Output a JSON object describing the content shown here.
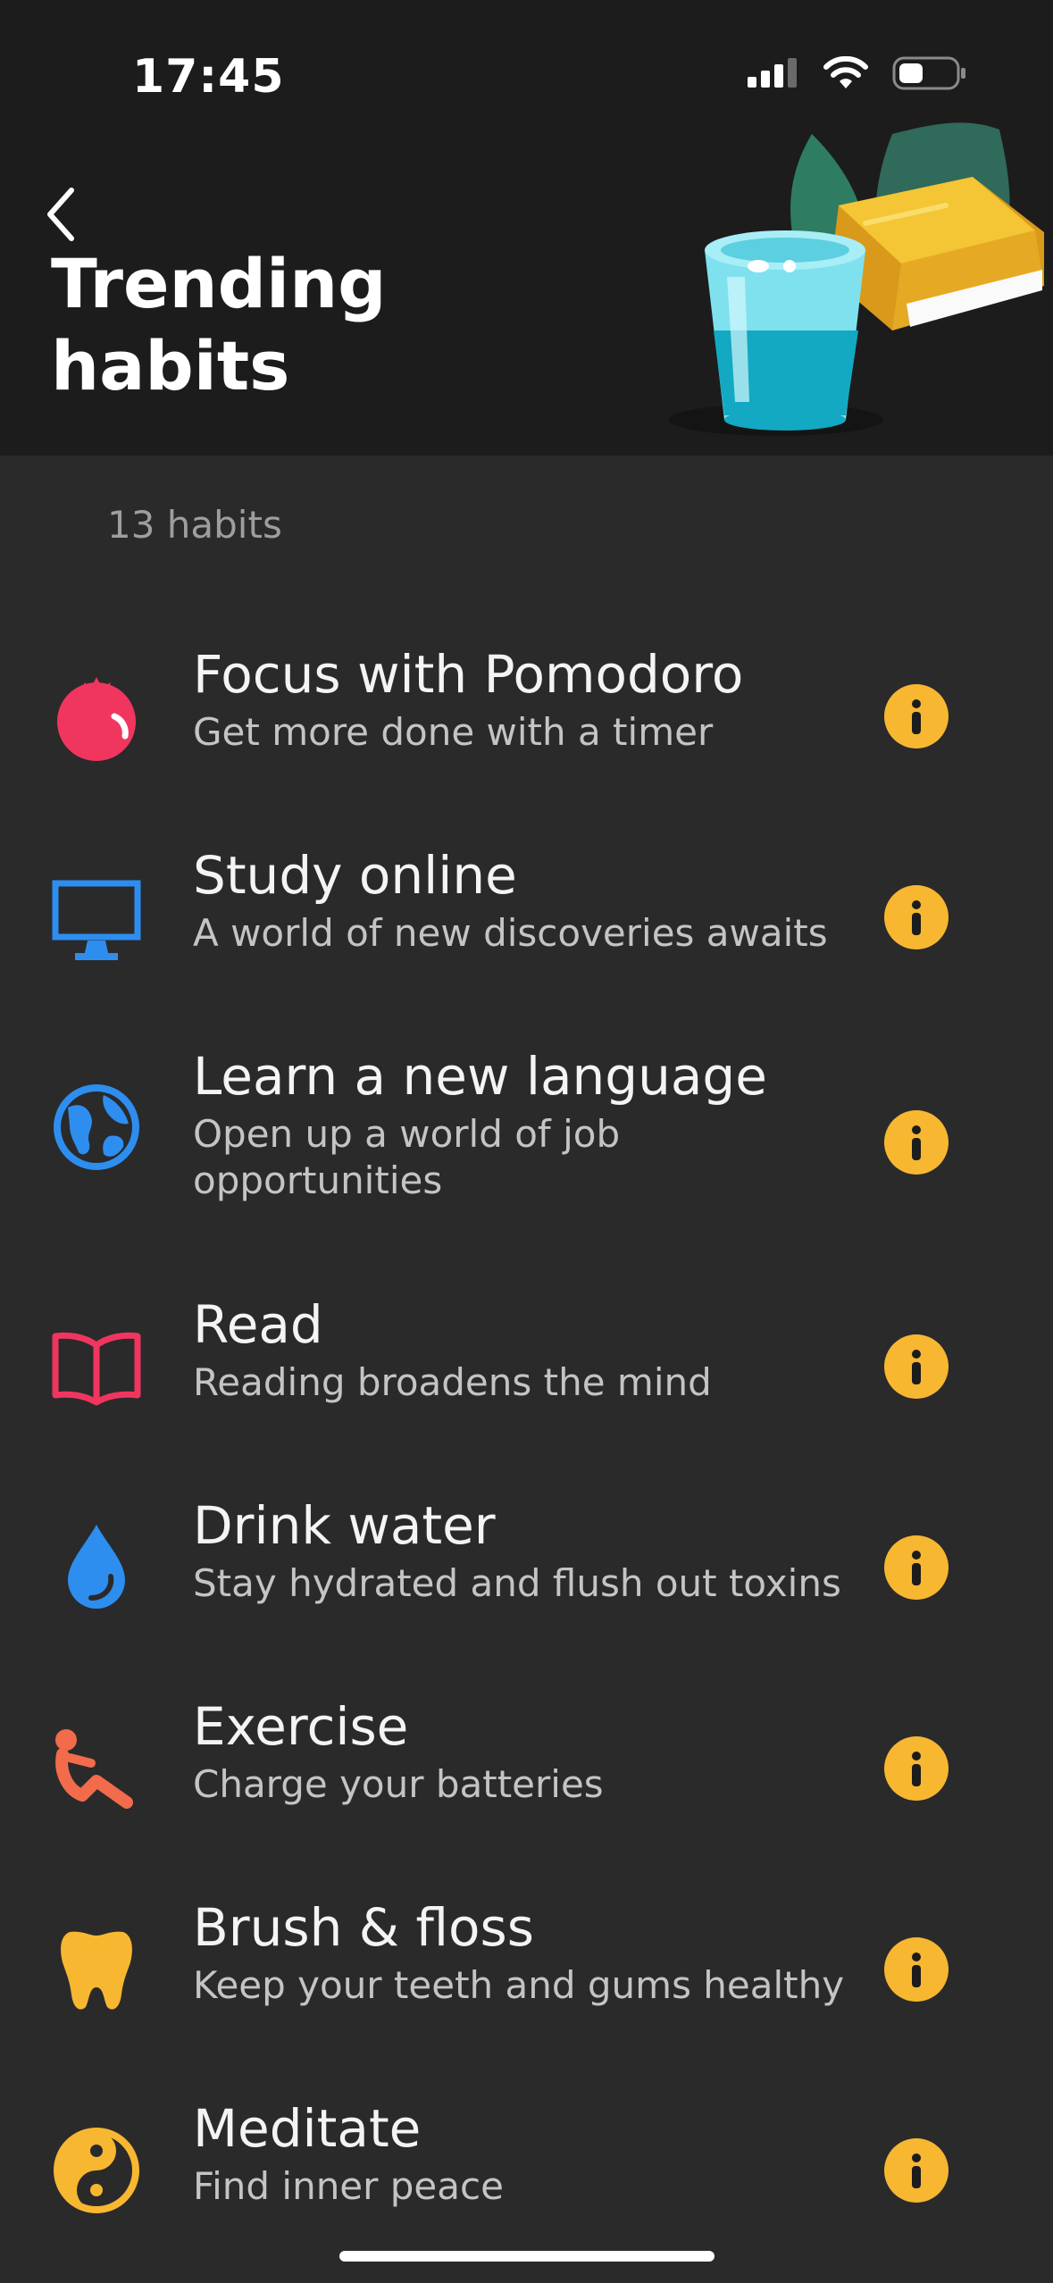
{
  "status_bar": {
    "time": "17:45"
  },
  "header": {
    "title": "Trending habits"
  },
  "count_label": "13 habits",
  "habits": [
    {
      "title": "Focus with Pomodoro",
      "subtitle": "Get more done with a timer",
      "icon": "tomato-icon",
      "color": "#f0365f"
    },
    {
      "title": "Study online",
      "subtitle": "A world of new discoveries awaits",
      "icon": "monitor-icon",
      "color": "#2d8ef0"
    },
    {
      "title": "Learn a new language",
      "subtitle": "Open up a world of job opportunities",
      "icon": "globe-icon",
      "color": "#2d8ef0"
    },
    {
      "title": "Read",
      "subtitle": "Reading broadens the mind",
      "icon": "open-book-icon",
      "color": "#f0365f"
    },
    {
      "title": "Drink water",
      "subtitle": "Stay hydrated and flush out toxins",
      "icon": "water-drop-icon",
      "color": "#2d8ef0"
    },
    {
      "title": "Exercise",
      "subtitle": "Charge your batteries",
      "icon": "situp-icon",
      "color": "#f26b4b"
    },
    {
      "title": "Brush & floss",
      "subtitle": "Keep your teeth and gums healthy",
      "icon": "tooth-icon",
      "color": "#f7b731"
    },
    {
      "title": "Meditate",
      "subtitle": "Find inner peace",
      "icon": "yin-yang-icon",
      "color": "#f7b731"
    }
  ],
  "colors": {
    "background": "#2a2a2b",
    "header": "#1c1c1d",
    "info_accent": "#f7b731"
  }
}
